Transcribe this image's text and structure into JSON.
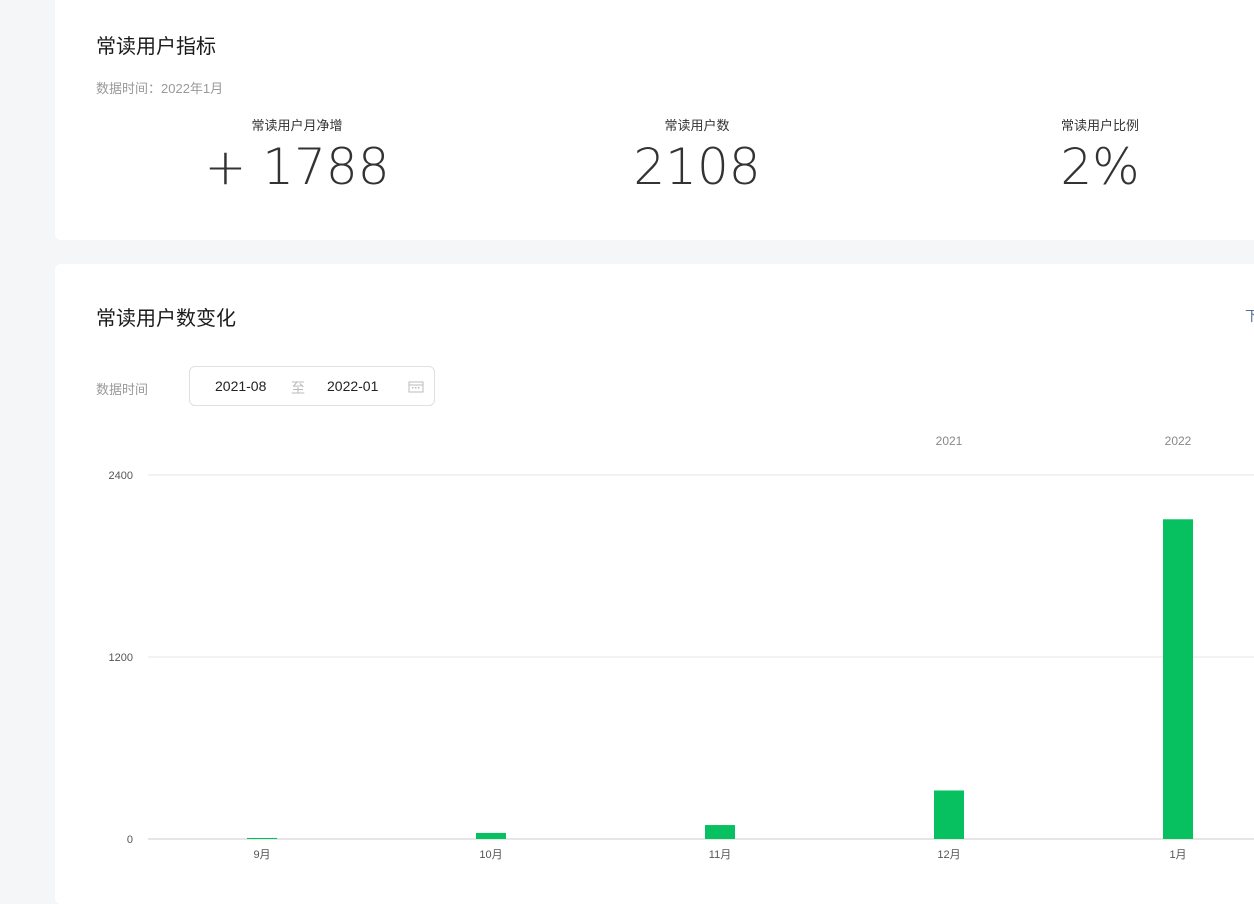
{
  "metrics_card": {
    "title": "常读用户指标",
    "data_time": "数据时间：2022年1月",
    "metrics": [
      {
        "label": "常读用户月净增",
        "value": "+ 1788"
      },
      {
        "label": "常读用户数",
        "value": "2108"
      },
      {
        "label": "常读用户比例",
        "value": "2%"
      }
    ]
  },
  "trend_card": {
    "title": "常读用户数变化",
    "download_link": "下",
    "data_time_label": "数据时间",
    "range_start": "2021-08",
    "range_sep": "至",
    "range_end": "2022-01"
  },
  "chart_data": {
    "type": "bar",
    "categories": [
      "9月",
      "10月",
      "11月",
      "12月",
      "1月"
    ],
    "year_labels": [
      {
        "label": "2021",
        "at": "12月"
      },
      {
        "label": "2022",
        "at": "1月"
      }
    ],
    "values": [
      7,
      40,
      92,
      320,
      2108
    ],
    "ylim": [
      0,
      2400
    ],
    "yticks": [
      "0",
      "1200",
      "2400"
    ],
    "color": "#07c160",
    "grid": true
  }
}
